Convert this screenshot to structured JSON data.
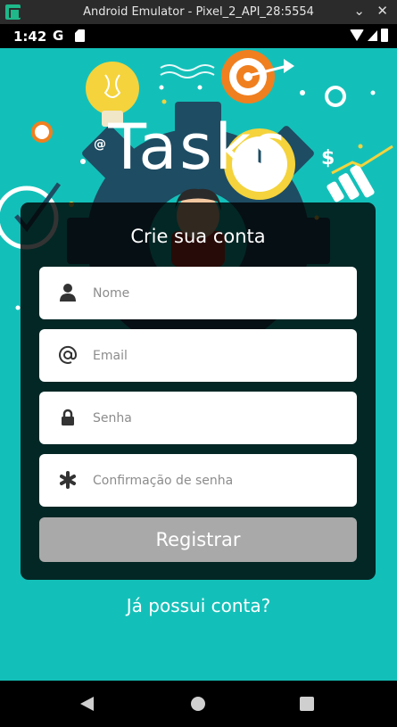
{
  "emulator": {
    "title": "Android Emulator - Pixel_2_API_28:5554",
    "minimize_icon": "chevron-down",
    "close_icon": "close-x"
  },
  "status_bar": {
    "time": "1:42",
    "google_icon": "G",
    "icons": [
      "sd-card-icon",
      "wifi-icon",
      "signal-icon",
      "battery-icon"
    ]
  },
  "app": {
    "title": "Tasks",
    "background_color": "#13c0b9"
  },
  "form": {
    "subtitle": "Crie sua conta",
    "fields": [
      {
        "icon": "user-icon",
        "placeholder": "Nome",
        "value": ""
      },
      {
        "icon": "at-icon",
        "placeholder": "Email",
        "value": ""
      },
      {
        "icon": "lock-icon",
        "placeholder": "Senha",
        "value": ""
      },
      {
        "icon": "asterisk-icon",
        "placeholder": "Confirmação de senha",
        "value": ""
      }
    ],
    "submit_label": "Registrar",
    "submit_color": "#a9a9a9"
  },
  "login_link": "Já possui conta?",
  "nav_bar": {
    "buttons": [
      "back",
      "home",
      "recents"
    ]
  }
}
